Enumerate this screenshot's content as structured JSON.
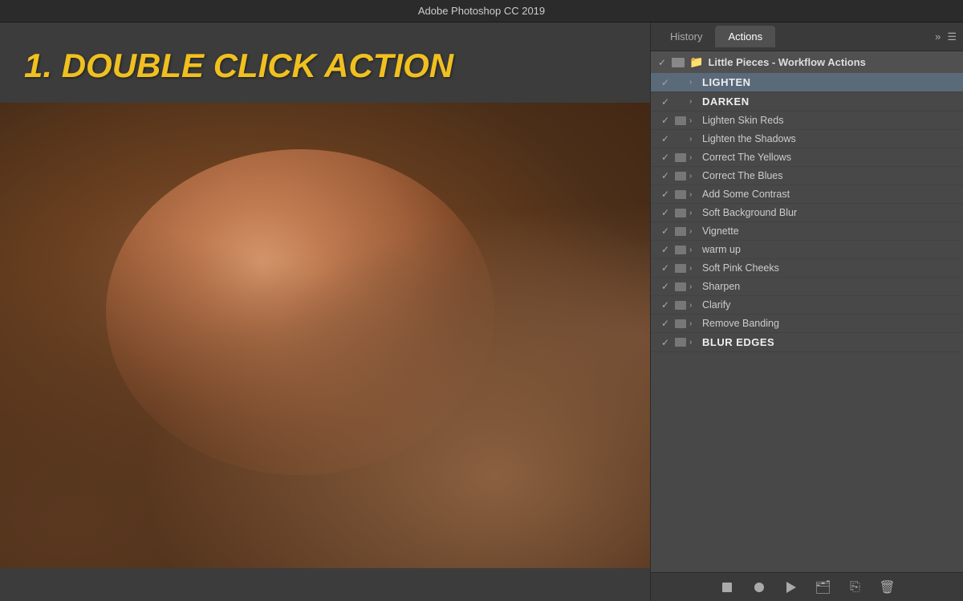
{
  "titlebar": {
    "title": "Adobe Photoshop CC 2019"
  },
  "tabs": {
    "history_label": "History",
    "actions_label": "Actions",
    "expand_icon": "»",
    "menu_icon": "☰"
  },
  "actions_panel": {
    "group": {
      "name": "Little Pieces - Workflow Actions"
    },
    "items": [
      {
        "id": 1,
        "name": "LIGHTEN",
        "checked": true,
        "has_stop": false,
        "bold": true,
        "selected": true
      },
      {
        "id": 2,
        "name": "DARKEN",
        "checked": true,
        "has_stop": false,
        "bold": true,
        "selected": false
      },
      {
        "id": 3,
        "name": "Lighten Skin Reds",
        "checked": true,
        "has_stop": true,
        "bold": false,
        "selected": false
      },
      {
        "id": 4,
        "name": "Lighten the Shadows",
        "checked": true,
        "has_stop": false,
        "bold": false,
        "selected": false
      },
      {
        "id": 5,
        "name": "Correct The Yellows",
        "checked": true,
        "has_stop": true,
        "bold": false,
        "selected": false
      },
      {
        "id": 6,
        "name": "Correct The Blues",
        "checked": true,
        "has_stop": true,
        "bold": false,
        "selected": false
      },
      {
        "id": 7,
        "name": "Add Some Contrast",
        "checked": true,
        "has_stop": true,
        "bold": false,
        "selected": false
      },
      {
        "id": 8,
        "name": "Soft Background Blur",
        "checked": true,
        "has_stop": true,
        "bold": false,
        "selected": false
      },
      {
        "id": 9,
        "name": "Vignette",
        "checked": true,
        "has_stop": true,
        "bold": false,
        "selected": false
      },
      {
        "id": 10,
        "name": "warm up",
        "checked": true,
        "has_stop": true,
        "bold": false,
        "selected": false
      },
      {
        "id": 11,
        "name": "Soft Pink Cheeks",
        "checked": true,
        "has_stop": true,
        "bold": false,
        "selected": false
      },
      {
        "id": 12,
        "name": "Sharpen",
        "checked": true,
        "has_stop": true,
        "bold": false,
        "selected": false
      },
      {
        "id": 13,
        "name": "Clarify",
        "checked": true,
        "has_stop": true,
        "bold": false,
        "selected": false
      },
      {
        "id": 14,
        "name": "Remove Banding",
        "checked": true,
        "has_stop": true,
        "bold": false,
        "selected": false
      },
      {
        "id": 15,
        "name": "BLUR EDGES",
        "checked": true,
        "has_stop": true,
        "bold": true,
        "selected": false
      }
    ]
  },
  "canvas": {
    "instruction": "1. DOUBLE CLICK ACTION"
  },
  "toolbar": {
    "stop_label": "stop",
    "record_label": "record",
    "play_label": "play",
    "create_set_label": "create set",
    "create_action_label": "create action",
    "delete_label": "delete"
  }
}
